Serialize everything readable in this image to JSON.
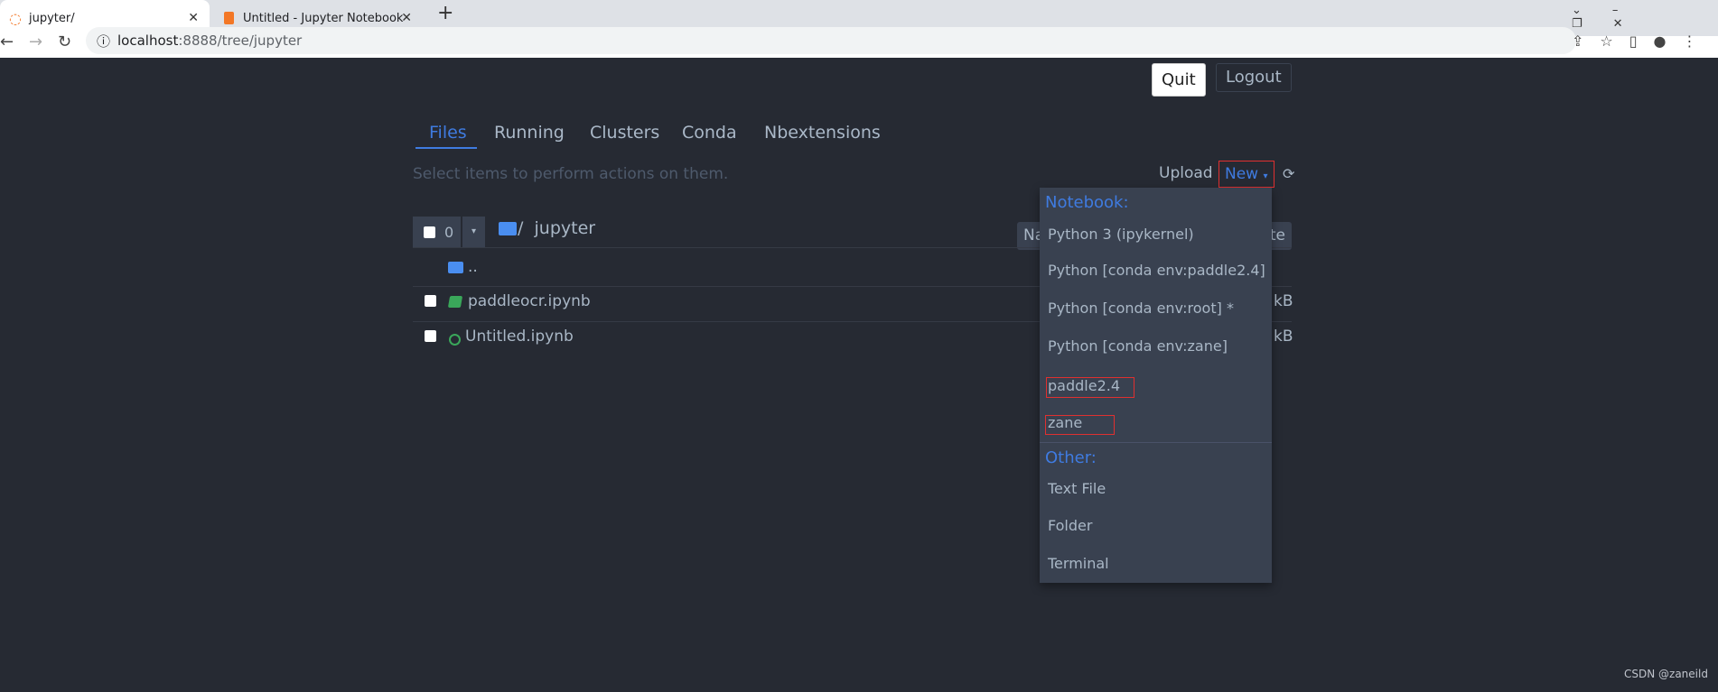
{
  "browser": {
    "tabs": [
      {
        "title": "jupyter/",
        "icon": "jupyter-logo-icon"
      },
      {
        "title": "Untitled - Jupyter Notebook",
        "icon": "notebook-icon"
      }
    ],
    "url_host": "localhost",
    "url_rest": ":8888/tree/jupyter"
  },
  "header": {
    "quit": "Quit",
    "logout": "Logout"
  },
  "nav_tabs": [
    "Files",
    "Running",
    "Clusters",
    "Conda",
    "Nbextensions"
  ],
  "toolbar": {
    "hint": "Select items to perform actions on them.",
    "upload": "Upload",
    "new": "New",
    "selected_count": "0",
    "breadcrumb_sep": "/",
    "breadcrumb": "jupyter"
  },
  "list_header": {
    "name_partial": "Na",
    "last_partial": "te"
  },
  "files": [
    {
      "name": "..",
      "type": "folder"
    },
    {
      "name": "paddleocr.ipynb",
      "type": "notebook",
      "size_partial": "kB"
    },
    {
      "name": "Untitled.ipynb",
      "type": "notebook-running",
      "size_partial": "kB"
    }
  ],
  "new_menu": {
    "notebook_header": "Notebook:",
    "notebook_items": [
      "Python 3 (ipykernel)",
      "Python [conda env:paddle2.4]",
      "Python [conda env:root] *",
      "Python [conda env:zane]",
      "paddle2.4",
      "zane"
    ],
    "other_header": "Other:",
    "other_items": [
      "Text File",
      "Folder",
      "Terminal"
    ]
  },
  "watermark": "CSDN @zaneild",
  "colors": {
    "background": "#262a33",
    "accent": "#3f7be0",
    "menu": "#394150",
    "highlight": "#e03030"
  }
}
